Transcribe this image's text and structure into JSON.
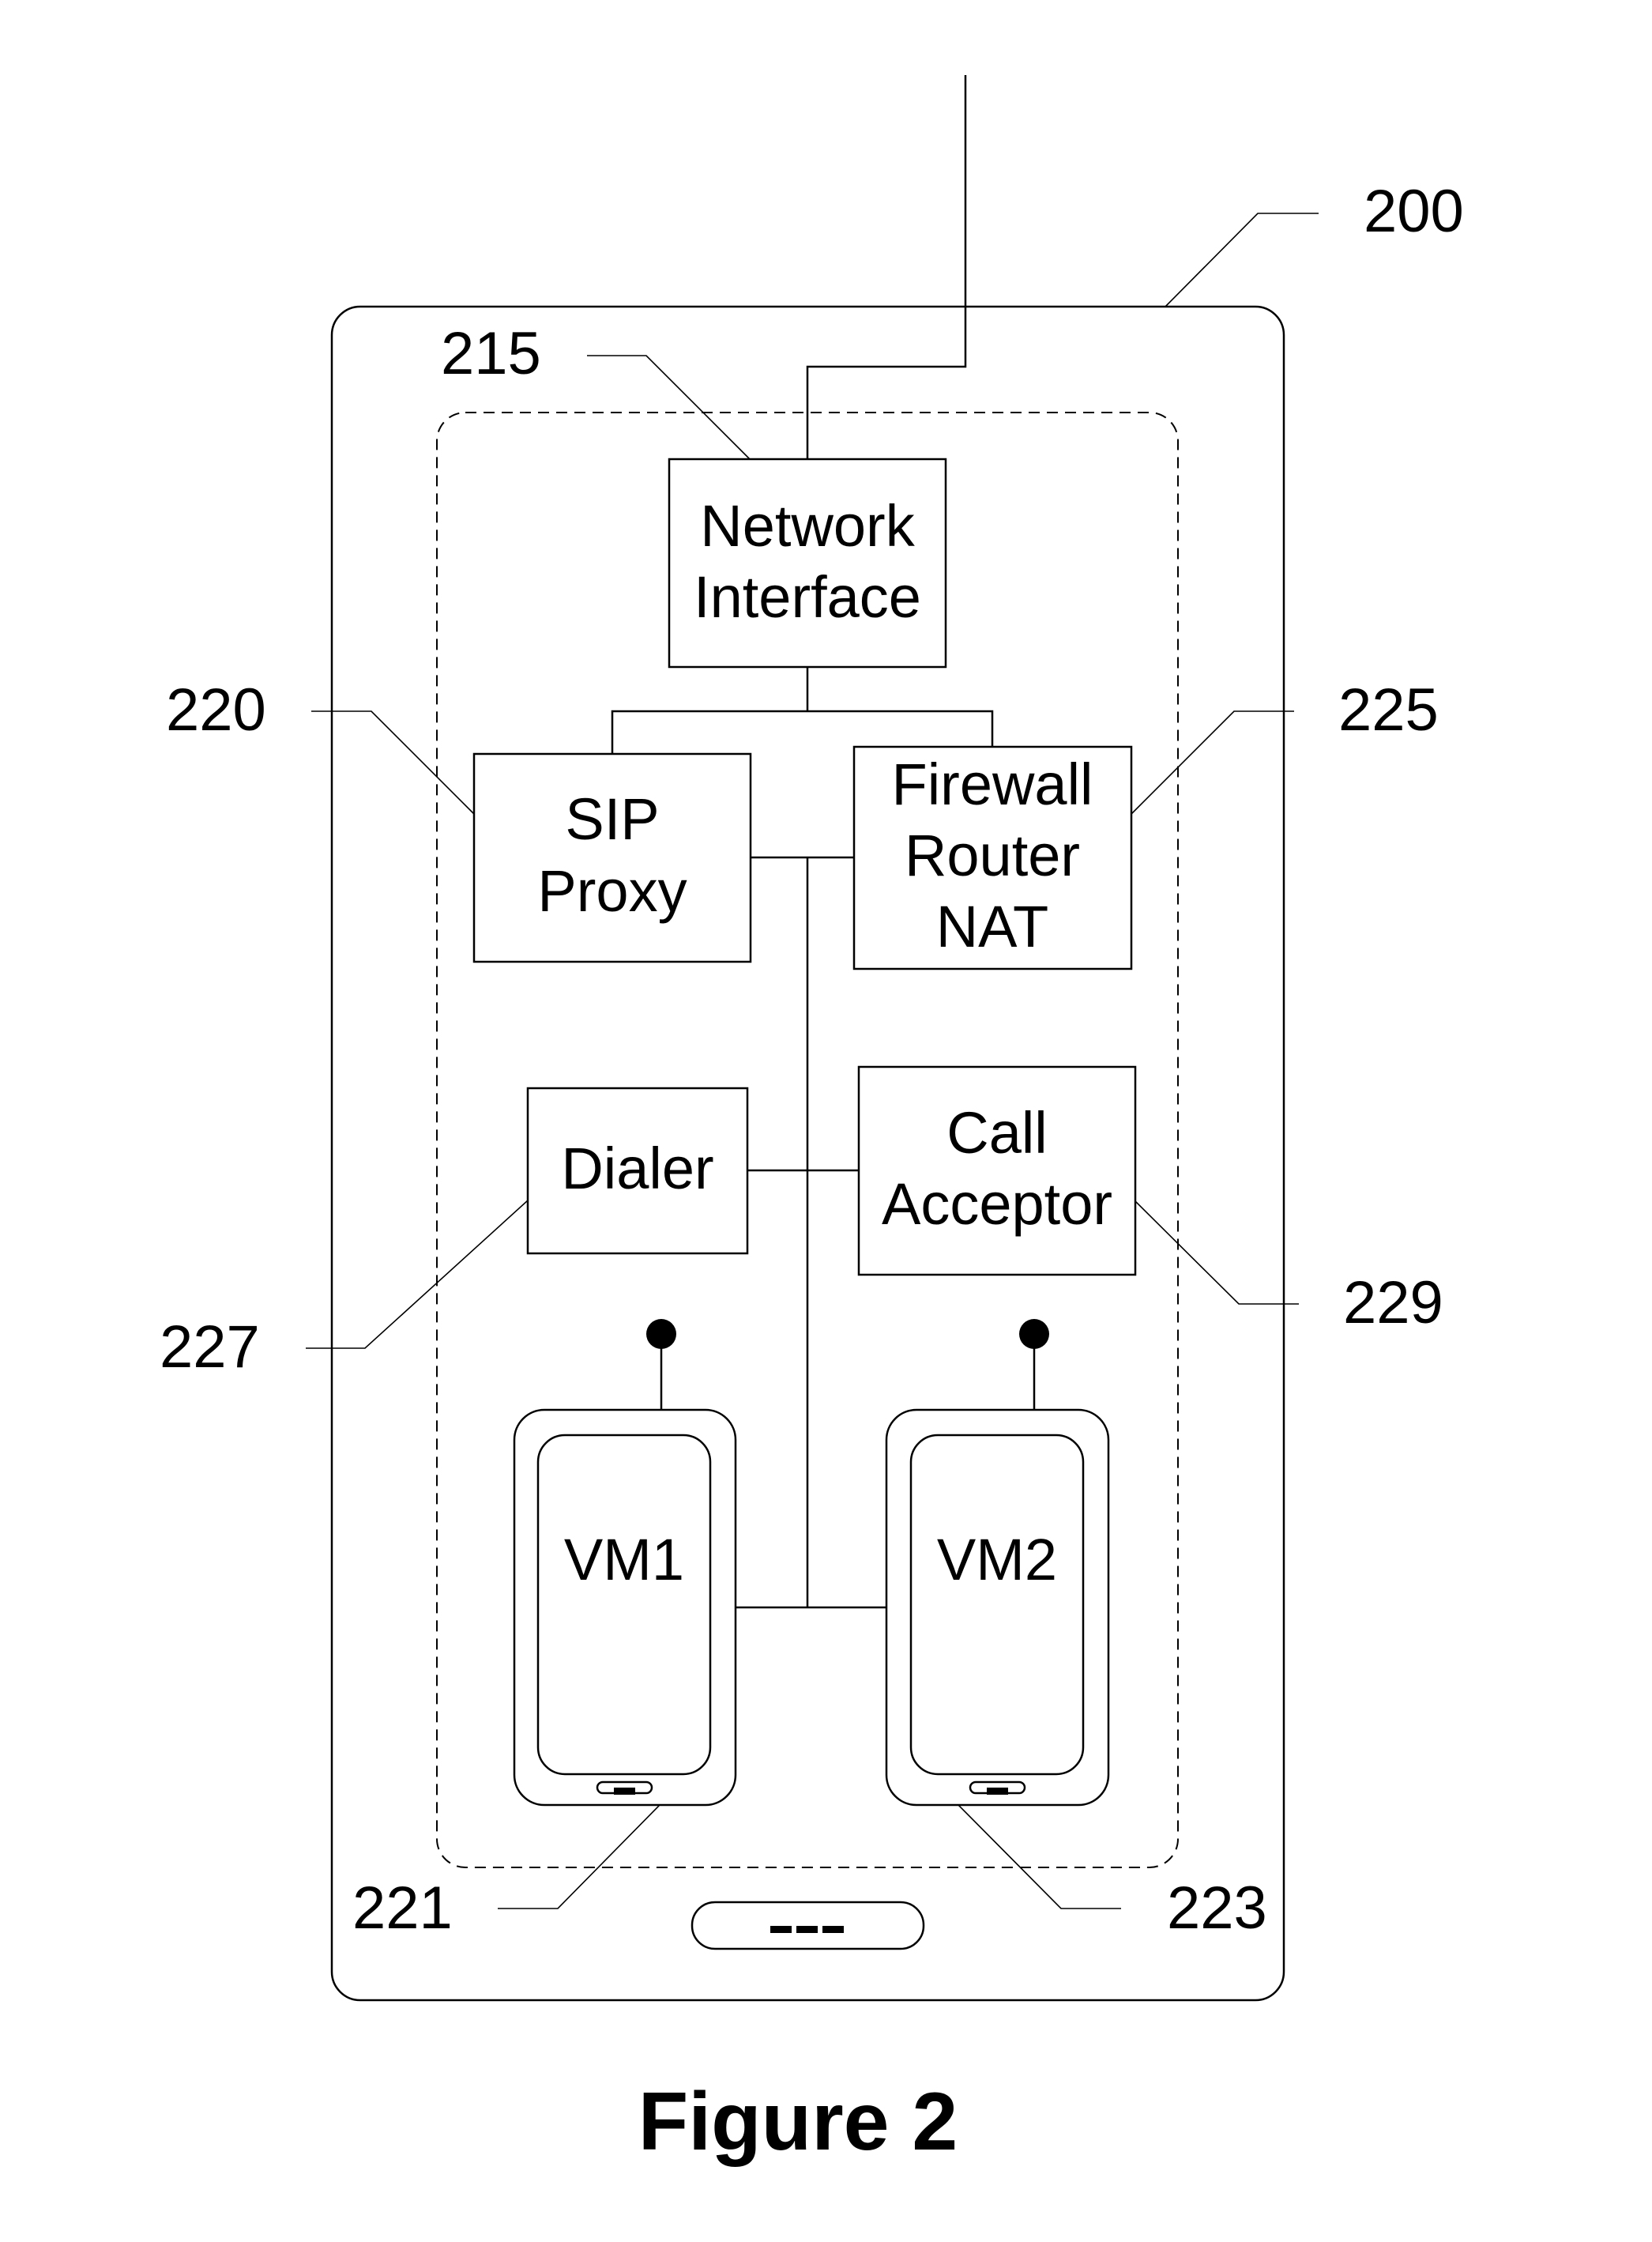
{
  "figure": {
    "caption": "Figure 2",
    "device_ref": "200"
  },
  "components": {
    "network_interface": {
      "ref": "215",
      "lines": [
        "Network",
        "Interface"
      ]
    },
    "sip_proxy": {
      "ref": "220",
      "lines": [
        "SIP",
        "Proxy"
      ]
    },
    "firewall": {
      "ref": "225",
      "lines": [
        "Firewall",
        "Router",
        "NAT"
      ]
    },
    "dialer": {
      "ref": "227",
      "lines": [
        "Dialer"
      ]
    },
    "call_acceptor": {
      "ref": "229",
      "lines": [
        "Call",
        "Acceptor"
      ]
    },
    "vm1": {
      "ref": "221",
      "label": "VM1"
    },
    "vm2": {
      "ref": "223",
      "label": "VM2"
    }
  },
  "device_button": {
    "icon": "three-dash-icon"
  }
}
